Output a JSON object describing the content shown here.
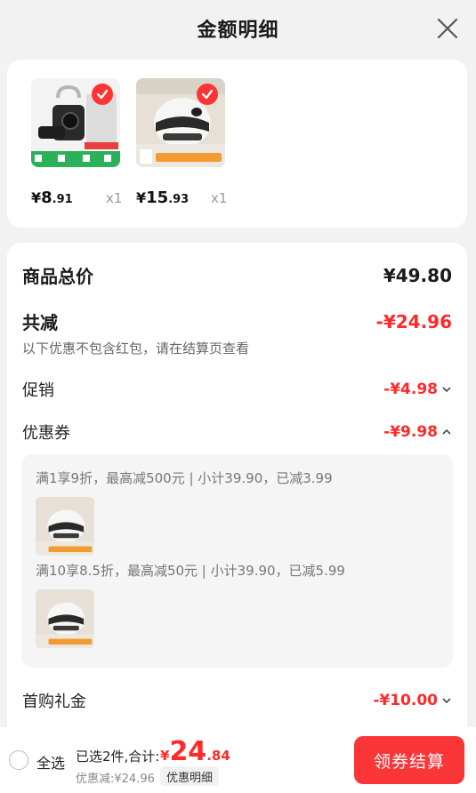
{
  "header": {
    "title": "金额明细",
    "close_icon": "close-icon"
  },
  "products": [
    {
      "currency": "¥",
      "price_int": "8",
      "price_dec": ".91",
      "qty": "x1",
      "selected": true,
      "image_icon": "phone-holder-image"
    },
    {
      "currency": "¥",
      "price_int": "15",
      "price_dec": ".93",
      "qty": "x1",
      "selected": true,
      "image_icon": "helmet-image"
    }
  ],
  "summary": {
    "total_label": "商品总价",
    "total_value": "¥49.80",
    "discount_label": "共减",
    "discount_value": "-¥24.96",
    "note": "以下优惠不包含红包，请在结算页查看",
    "promo_label": "促销",
    "promo_value": "-¥4.98",
    "coupon_label": "优惠券",
    "coupon_value": "-¥9.98",
    "coupons": [
      {
        "text": "满1享9折，最高减500元 | 小计39.90，已减3.99"
      },
      {
        "text": "满10享8.5折，最高减50元 | 小计39.90，已减5.99"
      }
    ],
    "gift_label": "首购礼金",
    "gift_value": "-¥10.00"
  },
  "footer": {
    "select_all": "全选",
    "selected_text": "已选2件,合计:",
    "total_currency": "¥",
    "total_int": "24",
    "total_dec": ".84",
    "saved_text": "优惠减:¥24.96",
    "detail_chip": "优惠明细",
    "checkout_label": "领券结算"
  },
  "colors": {
    "accent_red": "#ff2a2a",
    "button_red": "#fb3638",
    "background": "#f2f2f2"
  }
}
